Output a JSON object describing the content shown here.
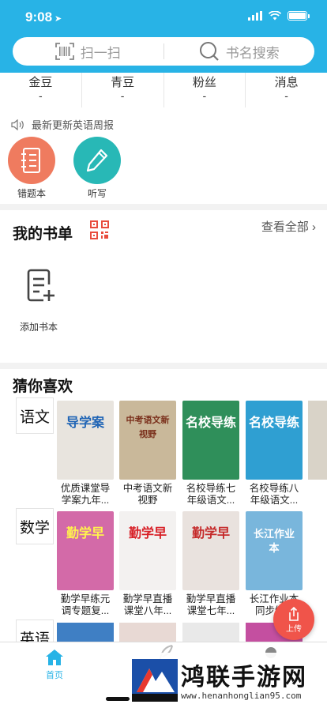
{
  "status": {
    "time": "9:08"
  },
  "search": {
    "scan_label": "扫一扫",
    "search_placeholder": "书名搜索"
  },
  "stats": [
    {
      "label": "金豆",
      "value": "-"
    },
    {
      "label": "青豆",
      "value": "-"
    },
    {
      "label": "粉丝",
      "value": "-"
    },
    {
      "label": "消息",
      "value": "-"
    }
  ],
  "notice": {
    "text": "最新更新英语周报"
  },
  "tools": [
    {
      "label": "错题本",
      "color": "#ef7b5f"
    },
    {
      "label": "听写",
      "color": "#28b8b6"
    }
  ],
  "booklist": {
    "title": "我的书单",
    "view_all": "查看全部",
    "add_label": "添加书本"
  },
  "recommend": {
    "title": "猜你喜欢",
    "subjects": [
      {
        "name": "语文",
        "books": [
          {
            "title": "优质课堂导学案九年...",
            "cover_text": "导学案",
            "cover_bg": "#e8e4de",
            "cover_fg": "#1f64b5"
          },
          {
            "title": "中考语文新视野",
            "cover_text": "中考语文新视野",
            "cover_bg": "#c9b89a",
            "cover_fg": "#7a2f1b"
          },
          {
            "title": "名校导练七年级语文...",
            "cover_text": "名校导练",
            "cover_bg": "#2f8f5a",
            "cover_fg": "#ffffff"
          },
          {
            "title": "名校导练八年级语文...",
            "cover_text": "名校导练",
            "cover_bg": "#2f9fd2",
            "cover_fg": "#ffffff"
          }
        ]
      },
      {
        "name": "数学",
        "books": [
          {
            "title": "勤学早练元调专题复...",
            "cover_text": "勤学早",
            "cover_bg": "#d36aa8",
            "cover_fg": "#fff34d"
          },
          {
            "title": "勤学早直播课堂八年...",
            "cover_text": "勤学早",
            "cover_bg": "#f3f1f0",
            "cover_fg": "#d81f26"
          },
          {
            "title": "勤学早直播课堂七年...",
            "cover_text": "勤学早",
            "cover_bg": "#e9e2de",
            "cover_fg": "#c52a2a"
          },
          {
            "title": "长江作业本同步练...",
            "cover_text": "长江作业本",
            "cover_bg": "#79b6dc",
            "cover_fg": "#ffffff"
          }
        ]
      },
      {
        "name": "英语",
        "books": []
      }
    ]
  },
  "upload": {
    "label": "上传"
  },
  "tabbar": {
    "home_label": "首页"
  },
  "watermark": {
    "title": "鸿联手游网",
    "url": "www.henanhonglian95.com"
  }
}
